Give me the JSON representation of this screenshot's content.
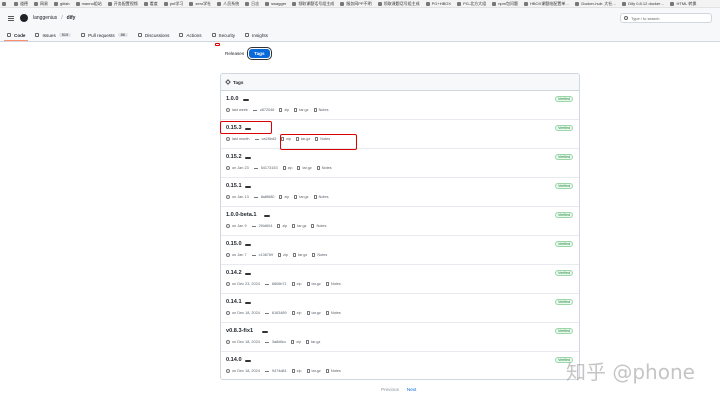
{
  "bookmarks": [
    "",
    "道德",
    "网易",
    "gitlab",
    "manno组站",
    "开务配置视频",
    "看度",
    "pnt学习",
    "zero学社",
    "人员系统",
    "日志",
    "swagger",
    "领取课题话号组主成",
    "服务网PP不明",
    "领取课题话号组主成",
    "PG+HBOX",
    "PG-北方大组",
    "npm包问题",
    "HBOX课题结配置单…",
    "Docker-hub: 大社…",
    "Dify 0.8.12 docker…",
    "HTML 转换"
  ],
  "header": {
    "owner": "langgenius",
    "repo": "dify",
    "search_placeholder": "Type / to search"
  },
  "nav": [
    {
      "label": "Code",
      "active": true
    },
    {
      "label": "Issues",
      "count": "519"
    },
    {
      "label": "Pull requests",
      "count": "86"
    },
    {
      "label": "Discussions"
    },
    {
      "label": "Actions"
    },
    {
      "label": "Security"
    },
    {
      "label": "Insights"
    }
  ],
  "subtabs": {
    "releases": "Releases",
    "tags": "Tags"
  },
  "panel_title": "Tags",
  "tags": [
    {
      "name": "1.0.0",
      "date": "last week",
      "sha": "c872046",
      "zip": "zip",
      "targz": "tar.gz",
      "notes": "Notes",
      "verified": "Verified"
    },
    {
      "name": "0.15.3",
      "date": "last month",
      "sha": "ca28bd3",
      "zip": "zip",
      "targz": "tar.gz",
      "notes": "Notes",
      "verified": "Verified"
    },
    {
      "name": "0.15.2",
      "date": "on Jan 23",
      "sha": "54173153",
      "zip": "zip",
      "targz": "tar.gz",
      "notes": "Notes",
      "verified": "Verified"
    },
    {
      "name": "0.15.1",
      "date": "on Jan 13",
      "sha": "8a8f680",
      "zip": "zip",
      "targz": "tar.gz",
      "notes": "Notes",
      "verified": "Verified"
    },
    {
      "name": "1.0.0-beta.1",
      "date": "on Jan 9",
      "sha": "2f4d604",
      "zip": "zip",
      "targz": "tar.gz",
      "notes": "Notes",
      "verified": "Verified"
    },
    {
      "name": "0.15.0",
      "date": "on Jan 7",
      "sha": "c136769",
      "zip": "zip",
      "targz": "tar.gz",
      "notes": "Notes",
      "verified": "Verified"
    },
    {
      "name": "0.14.2",
      "date": "on Dec 23, 2024",
      "sha": "6806b71",
      "zip": "zip",
      "targz": "tar.gz",
      "notes": "Notes",
      "verified": "Verified"
    },
    {
      "name": "0.14.1",
      "date": "on Dec 18, 2024",
      "sha": "6163489",
      "zip": "zip",
      "targz": "tar.gz",
      "notes": "Notes",
      "verified": "Verified"
    },
    {
      "name": "v0.8.3-fix1",
      "date": "on Dec 18, 2024",
      "sha": "3a8d6cc",
      "zip": "zip",
      "targz": "tar.gz",
      "notes": "Notes",
      "verified": "Verified"
    },
    {
      "name": "0.14.0",
      "date": "on Dec 18, 2024",
      "sha": "9474d81",
      "zip": "zip",
      "targz": "tar.gz",
      "notes": "Notes",
      "verified": "Verified"
    }
  ],
  "pager": {
    "previous": "Previous",
    "next": "Next"
  },
  "watermark": "知乎 @phone"
}
